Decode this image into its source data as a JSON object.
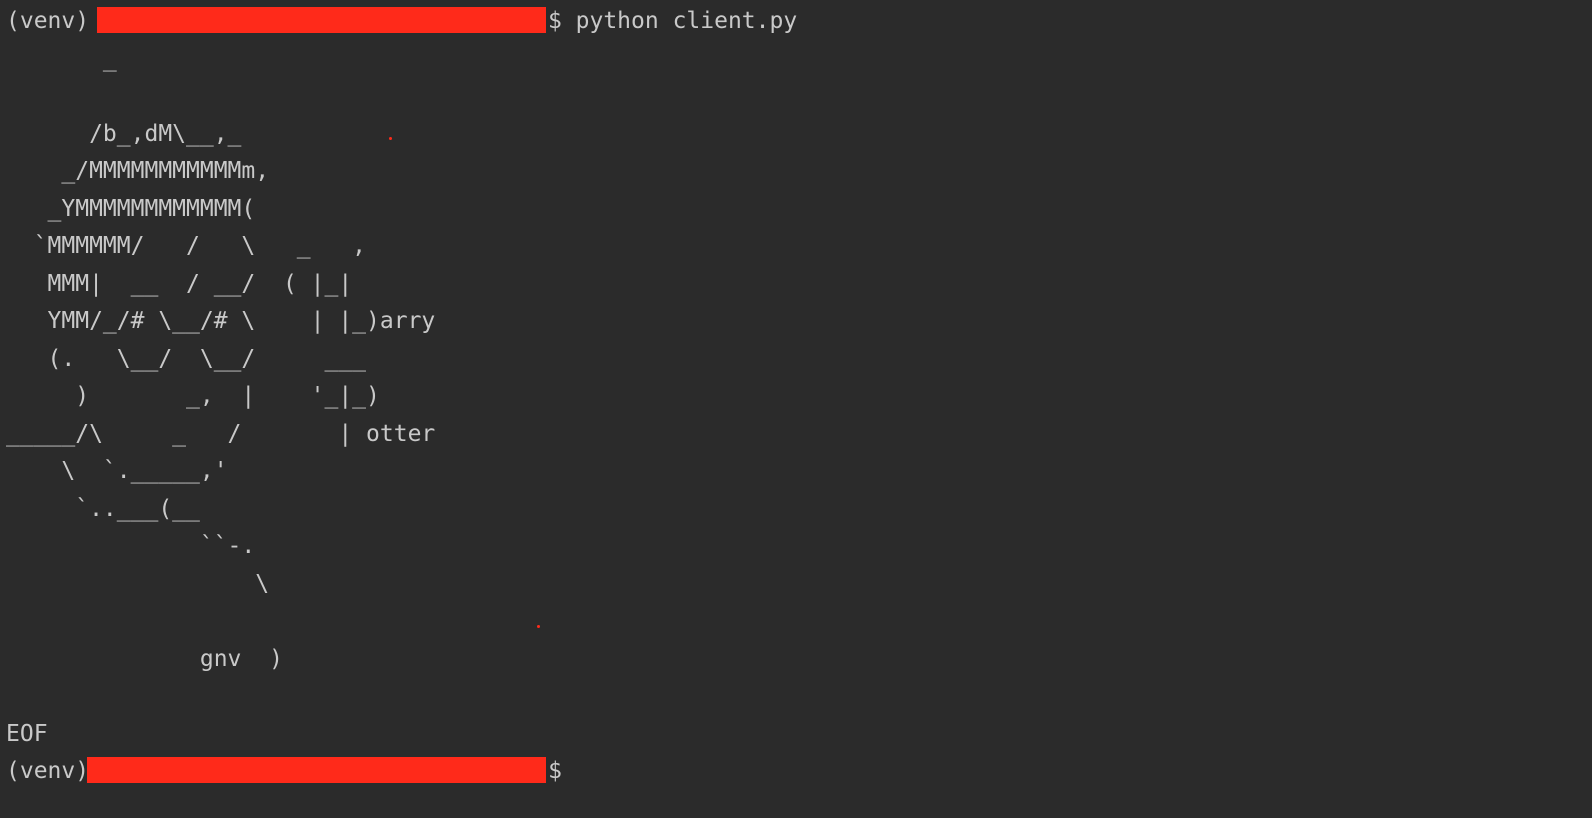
{
  "terminal": {
    "prompt_prefix": "(venv) ",
    "prompt_prefix_short": "(venv)",
    "prompt_symbol": "$ ",
    "prompt_symbol_end": "$",
    "command": "python client.py",
    "output_lines": [
      "       _",
      "",
      "      /b_,dM\\__,_",
      "    _/MMMMMMMMMMMm,",
      "   _YMMMMMMMMMMMM(",
      "  `MMMMMM/   /   \\   _   ,",
      "   MMM|  __  / __/  ( |_|",
      "   YMM/_/# \\__/# \\    | |_)arry",
      "   (.   \\__/  \\__/     ___",
      "     )       _,  |    '_|_)",
      "_____/\\     _   /       | otter",
      "    \\  `._____,'",
      "     `..___(__",
      "              ``-.",
      "                  \\",
      "",
      "              gnv  )",
      ""
    ],
    "eof": "EOF",
    "redaction_color": "#ff2a1a"
  }
}
